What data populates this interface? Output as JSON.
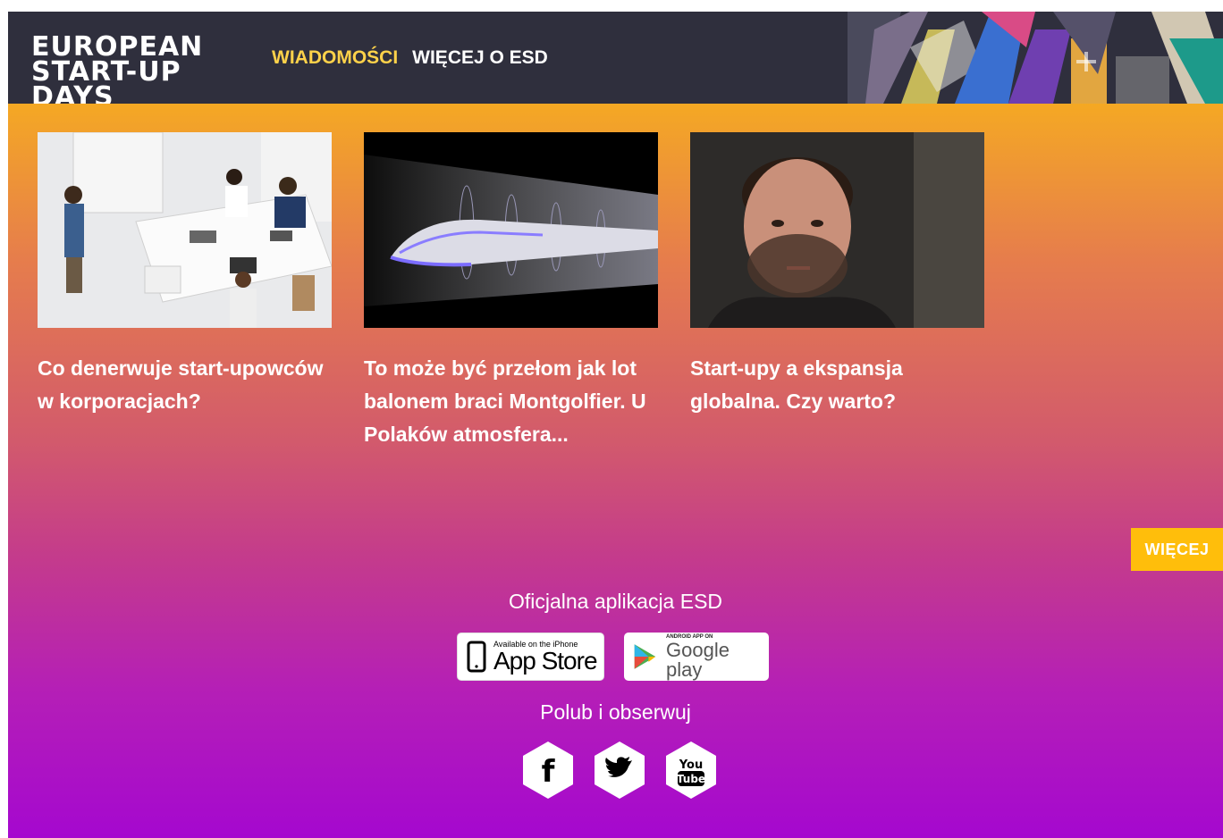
{
  "header": {
    "logo_lines": [
      "EUROPEAN",
      "START-UP",
      "DAYS"
    ],
    "nav": [
      {
        "label": "WIADOMOŚCI",
        "active": true
      },
      {
        "label": "WIĘCEJ O ESD",
        "active": false
      }
    ]
  },
  "articles": [
    {
      "title": "Co denerwuje start-upowców w korporacjach?",
      "image": "office-meeting-photo"
    },
    {
      "title": "To może być przełom jak lot balonem braci Montgolfier. U Polaków atmosfera...",
      "image": "hyperloop-train-render"
    },
    {
      "title": "Start-upy a ekspansja globalna. Czy warto?",
      "image": "portrait-photo"
    }
  ],
  "more_button": "WIĘCEJ",
  "footer": {
    "app_heading": "Oficjalna aplikacja ESD",
    "app_store": {
      "small": "Available on the iPhone",
      "big": "App Store"
    },
    "google_play": {
      "small": "ANDROID APP ON",
      "big": "Google play"
    },
    "follow_heading": "Polub i obserwuj",
    "social": [
      {
        "icon": "facebook-icon",
        "glyph": "f"
      },
      {
        "icon": "twitter-icon"
      },
      {
        "icon": "youtube-icon",
        "line1": "You",
        "line2": "Tube"
      }
    ]
  },
  "colors": {
    "header_bg": "#2f2f3d",
    "accent_yellow": "#ffc000",
    "gradient_bottom": "#a508cf",
    "active_nav": "#ffd24a"
  }
}
